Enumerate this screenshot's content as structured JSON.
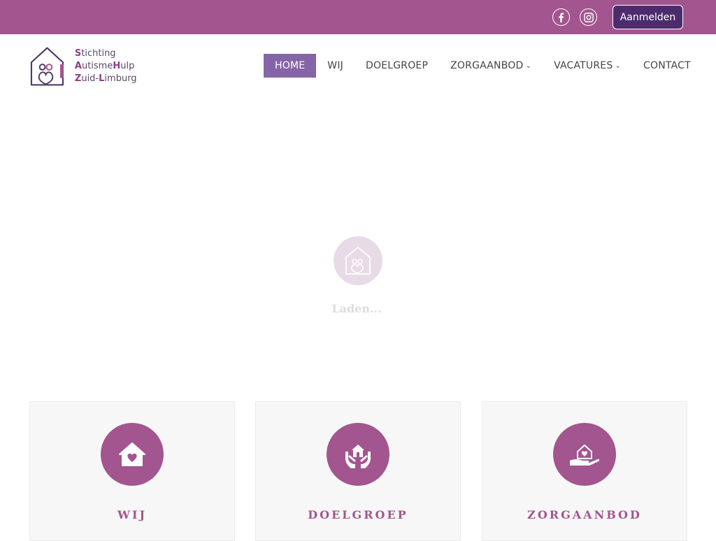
{
  "topbar": {
    "social": [
      {
        "name": "facebook-icon"
      },
      {
        "name": "instagram-icon"
      }
    ],
    "login_label": "Aanmelden"
  },
  "logo": {
    "line1": [
      {
        "cap": "S",
        "rest": "tichting "
      },
      {
        "cap": "A",
        "rest": "utisme"
      },
      {
        "cap": "H",
        "rest": "ulp"
      }
    ],
    "line2": [
      {
        "cap": "Z",
        "rest": "uid-"
      },
      {
        "cap": "L",
        "rest": "imburg"
      }
    ]
  },
  "nav": {
    "items": [
      {
        "label": "HOME",
        "active": true,
        "dropdown": false
      },
      {
        "label": "WIJ",
        "active": false,
        "dropdown": false
      },
      {
        "label": "DOELGROEP",
        "active": false,
        "dropdown": false
      },
      {
        "label": "ZORGAANBOD",
        "active": false,
        "dropdown": true
      },
      {
        "label": "VACATURES",
        "active": false,
        "dropdown": true
      },
      {
        "label": "CONTACT",
        "active": false,
        "dropdown": false
      }
    ]
  },
  "loader": {
    "text": "Laden..."
  },
  "cards": [
    {
      "title": "WIJ",
      "icon": "house-heart-icon"
    },
    {
      "title": "DOELGROEP",
      "icon": "hands-house-icon"
    },
    {
      "title": "ZORGAANBOD",
      "icon": "hand-care-icon"
    }
  ],
  "colors": {
    "brand": "#a3558f",
    "active_nav": "#8565a8",
    "login_bg": "#4d2c6e"
  }
}
